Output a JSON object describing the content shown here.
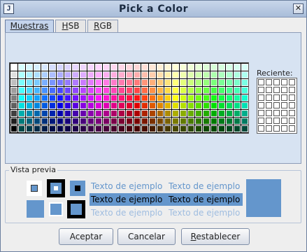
{
  "window": {
    "title": "Pick a Color",
    "app_icon": "java-icon",
    "close_glyph": "✕"
  },
  "tabs": [
    {
      "label": "Muestras",
      "active": true
    },
    {
      "label": "HSB",
      "active": false
    },
    {
      "label": "RGB",
      "active": false
    }
  ],
  "swatches": {
    "columns": 31,
    "rows": 9,
    "rows_lightness": [
      0.92,
      0.84,
      0.74,
      0.64,
      0.54,
      0.44,
      0.34,
      0.24,
      0.14
    ]
  },
  "recent": {
    "label": "Reciente:",
    "columns": 5,
    "rows": 7
  },
  "preview": {
    "label": "Vista previa",
    "sample_text": "Texto de ejemplo",
    "selected_color": "#6496cc",
    "text_color": "#6496cc",
    "selected_text_color": "#000000"
  },
  "buttons": {
    "accept": "Aceptar",
    "cancel": "Cancelar",
    "reset": "Restablecer"
  }
}
